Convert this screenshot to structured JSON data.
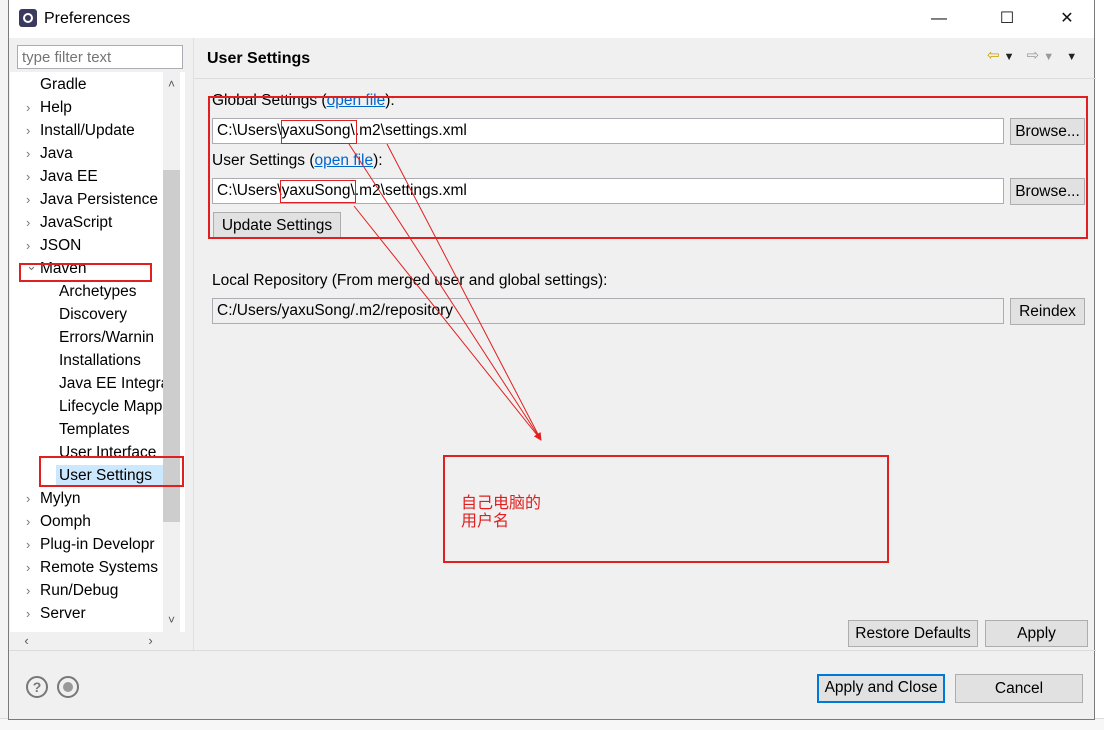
{
  "window": {
    "title": "Preferences"
  },
  "filter": {
    "placeholder": "type filter text"
  },
  "tree": {
    "items": [
      {
        "label": "Gradle",
        "caret": ""
      },
      {
        "label": "Help",
        "caret": "›"
      },
      {
        "label": "Install/Update",
        "caret": "›"
      },
      {
        "label": "Java",
        "caret": "›"
      },
      {
        "label": "Java EE",
        "caret": "›"
      },
      {
        "label": "Java Persistence",
        "caret": "›"
      },
      {
        "label": "JavaScript",
        "caret": "›"
      },
      {
        "label": "JSON",
        "caret": "›"
      },
      {
        "label": "Maven",
        "caret": "⌄"
      },
      {
        "label": "Archetypes",
        "caret": ""
      },
      {
        "label": "Discovery",
        "caret": ""
      },
      {
        "label": "Errors/Warnin",
        "caret": ""
      },
      {
        "label": "Installations",
        "caret": ""
      },
      {
        "label": "Java EE Integra",
        "caret": ""
      },
      {
        "label": "Lifecycle Mapp",
        "caret": ""
      },
      {
        "label": "Templates",
        "caret": ""
      },
      {
        "label": "User Interface",
        "caret": ""
      },
      {
        "label": "User Settings",
        "caret": ""
      },
      {
        "label": "Mylyn",
        "caret": "›"
      },
      {
        "label": "Oomph",
        "caret": "›"
      },
      {
        "label": "Plug-in Developr",
        "caret": "›"
      },
      {
        "label": "Remote Systems",
        "caret": "›"
      },
      {
        "label": "Run/Debug",
        "caret": "›"
      },
      {
        "label": "Server",
        "caret": "›"
      }
    ]
  },
  "page": {
    "title": "User Settings",
    "global_label": "Global Settings (",
    "global_label_link": "open file",
    "global_label_end": "):",
    "global_path": "C:\\Users\\yaxuSong\\.m2\\settings.xml",
    "user_label": "User Settings (",
    "user_label_link": "open file",
    "user_label_end": "):",
    "user_path": "C:\\Users\\yaxuSong\\.m2\\settings.xml",
    "browse_label": "Browse...",
    "update_label": "Update Settings",
    "local_repo_label": "Local Repository (From merged user and global settings):",
    "local_repo_path": "C:/Users/yaxuSong/.m2/repository",
    "reindex_label": "Reindex",
    "restore_defaults_label": "Restore Defaults",
    "apply_label": "Apply"
  },
  "annotation": {
    "line1": "自己电脑的",
    "line2": "用户名"
  },
  "footer": {
    "help_icon": "?",
    "apply_close_label": "Apply and Close",
    "cancel_label": "Cancel"
  },
  "colors": {
    "annotation_red": "#e02020",
    "selection": "#cce8ff",
    "link": "#0066cc",
    "default_button_border": "#0078d7"
  }
}
